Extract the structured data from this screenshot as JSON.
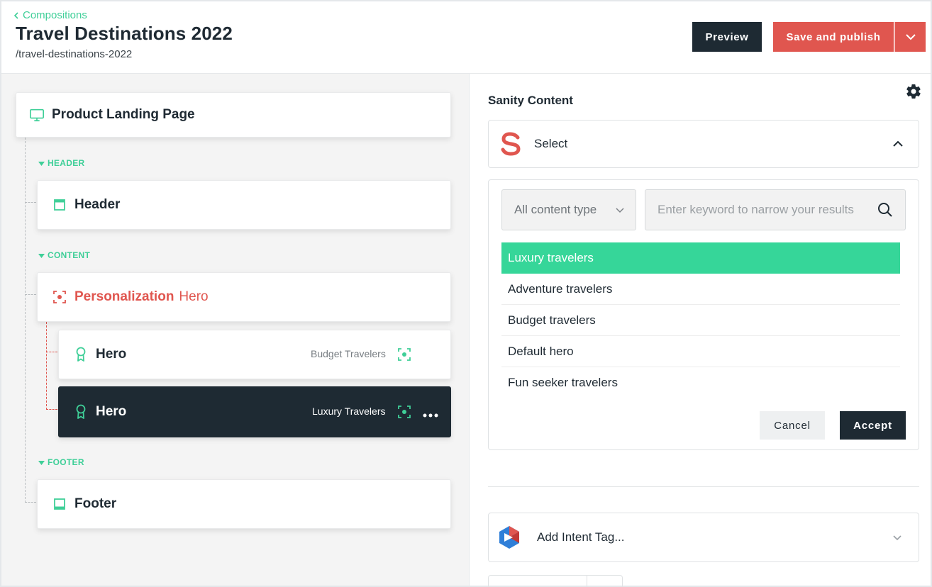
{
  "header": {
    "breadcrumb": "Compositions",
    "title": "Travel Destinations 2022",
    "slug": "/travel-destinations-2022",
    "preview_label": "Preview",
    "publish_label": "Save and publish"
  },
  "tree": {
    "root_label": "Product Landing Page",
    "sections": {
      "header": "HEADER",
      "content": "CONTENT",
      "footer": "FOOTER"
    },
    "header_label": "Header",
    "personalization": {
      "label": "Personalization",
      "sublabel": "Hero"
    },
    "variants": [
      {
        "label": "Hero",
        "tag": "Budget Travelers"
      },
      {
        "label": "Hero",
        "tag": "Luxury Travelers"
      }
    ],
    "footer_label": "Footer"
  },
  "panel": {
    "title": "Sanity Content",
    "select_label": "Select",
    "content_type": "All content type",
    "search_placeholder": "Enter keyword to narrow your results",
    "options": [
      "Luxury travelers",
      "Adventure travelers",
      "Budget travelers",
      "Default hero",
      "Fun seeker travelers"
    ],
    "selected_option": "Luxury travelers",
    "cancel_label": "Cancel",
    "accept_label": "Accept",
    "intent_label": "Add Intent Tag..."
  },
  "colors": {
    "accent_green": "#36d699",
    "brand_red": "#e0564f",
    "dark": "#1e2a33"
  },
  "icons": [
    "chevron-left-icon",
    "monitor-icon",
    "header-layout-icon",
    "personalization-target-icon",
    "award-ribbon-icon",
    "more-dots-icon",
    "footer-layout-icon",
    "gear-icon",
    "sanity-logo-icon",
    "chevron-up-icon",
    "chevron-down-icon",
    "search-icon",
    "intent-tag-logo-icon"
  ]
}
